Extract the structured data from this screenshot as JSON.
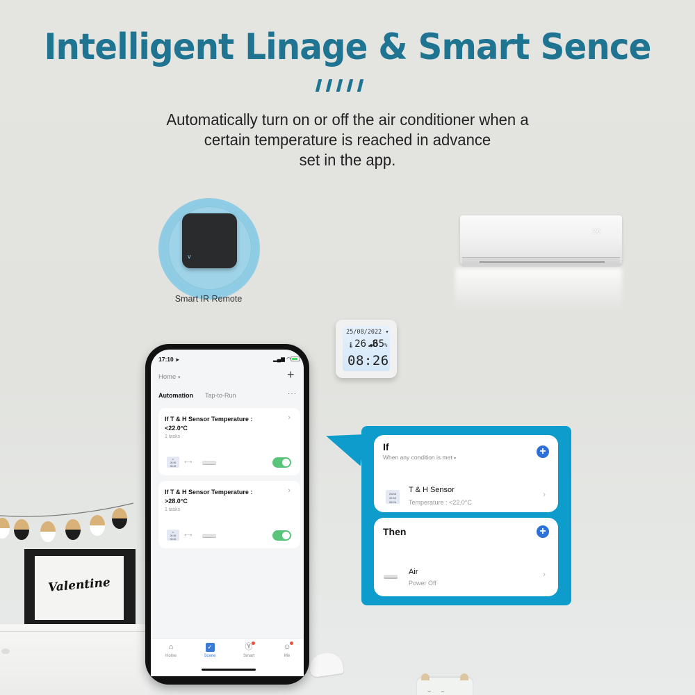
{
  "header": {
    "title": "Intelligent Linage & Smart Sence",
    "subtitle_lines": [
      "Automatically turn on or off the air conditioner when a",
      "certain temperature is reached in advance",
      "set in the app."
    ]
  },
  "colors": {
    "brand_teal": "#1e7491",
    "callout_blue": "#0e9ccc",
    "accent_blue": "#2f6fd8",
    "toggle_green": "#5ac47a"
  },
  "devices": {
    "ir_remote_label": "Smart IR Remote",
    "ir_remote_led": "v",
    "ac_display": "26",
    "thermometer": {
      "date": "25/08/2022",
      "temperature": "26.8",
      "temperature_unit": "°C",
      "humidity": "65",
      "humidity_unit": "%",
      "time": "08:26"
    }
  },
  "decor": {
    "frame_text": "Valentine"
  },
  "phone": {
    "status_time": "17:10",
    "status_icons": "signal-wifi-battery",
    "home_selector": "Home",
    "add_icon": "+",
    "tabs": [
      {
        "label": "Automation",
        "active": true
      },
      {
        "label": "Tap-to-Run",
        "active": false
      }
    ],
    "more_icon": "···",
    "automations": [
      {
        "title": "If T & H Sensor Temperature : <22.0°C",
        "tasks": "1 tasks",
        "enabled": true
      },
      {
        "title": "If T & H Sensor Temperature : >28.0°C",
        "tasks": "1 tasks",
        "enabled": true
      }
    ],
    "tabbar": [
      {
        "label": "Home",
        "icon": "home-icon",
        "active": false,
        "badge": false
      },
      {
        "label": "Scene",
        "icon": "scene-check-icon",
        "active": true,
        "badge": false
      },
      {
        "label": "Smart",
        "icon": "smart-icon",
        "active": false,
        "badge": true
      },
      {
        "label": "Me",
        "icon": "profile-icon",
        "active": false,
        "badge": true
      }
    ]
  },
  "callout": {
    "if_panel": {
      "heading": "If",
      "condition_mode": "When any condition is met",
      "items": [
        {
          "title": "T & H Sensor",
          "subtitle": "Temperature : <22.0°C"
        }
      ]
    },
    "then_panel": {
      "heading": "Then",
      "items": [
        {
          "title": "Air",
          "subtitle": "Power Off"
        }
      ]
    }
  }
}
